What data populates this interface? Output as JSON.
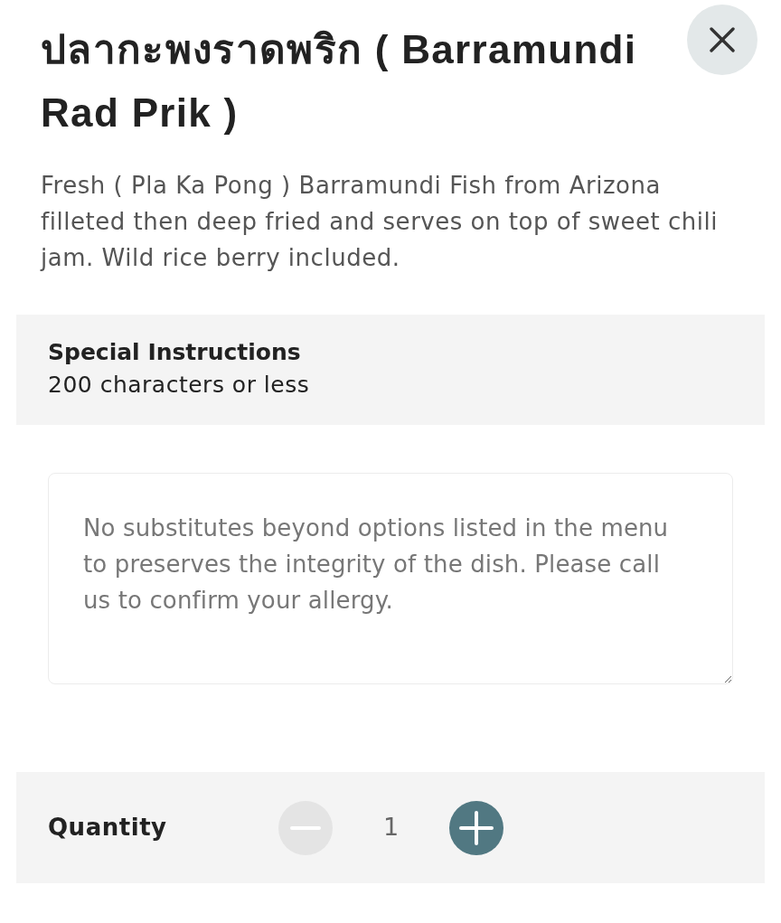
{
  "title": "ปลากะพงราดพริก ( Barramundi Rad Prik )",
  "description": "Fresh ( Pla Ka Pong ) Barramundi Fish from Arizona filleted then deep fried and serves on top of sweet chili jam. Wild rice berry included.",
  "special_instructions": {
    "title": "Special Instructions",
    "subtitle": "200 characters or less",
    "placeholder": "No substitutes beyond options listed in the menu to preserves the integrity of the dish. Please call us to confirm your allergy."
  },
  "quantity": {
    "label": "Quantity",
    "value": "1",
    "decrease": {
      "disabled": true
    },
    "increase": {
      "disabled": false
    }
  }
}
